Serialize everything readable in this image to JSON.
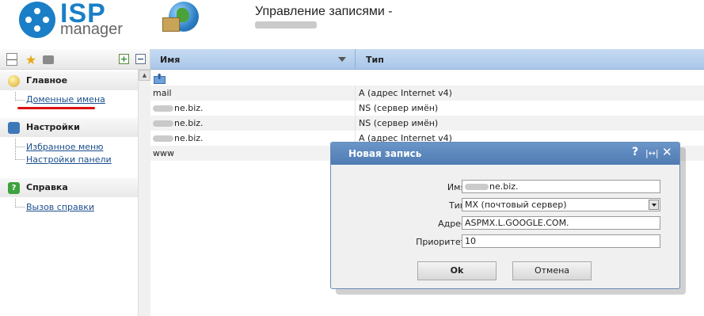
{
  "header": {
    "logo_top": "ISP",
    "logo_bottom": "manager",
    "title": "Управление записями -"
  },
  "sidebar": {
    "sections": [
      {
        "label": "Главное",
        "links": [
          "Доменные имена"
        ]
      },
      {
        "label": "Настройки",
        "links": [
          "Избранное меню",
          "Настройки панели"
        ]
      },
      {
        "label": "Справка",
        "links": [
          "Вызов справки"
        ]
      }
    ]
  },
  "table": {
    "columns": [
      "Имя",
      "Тип"
    ],
    "rows": [
      {
        "name": "mail",
        "type": "A (адрес Internet v4)"
      },
      {
        "name": "ne.biz.",
        "type": "NS (сервер имён)"
      },
      {
        "name": "ne.biz.",
        "type": "NS (сервер имён)"
      },
      {
        "name": "ne.biz.",
        "type": "A (адрес Internet v4)"
      },
      {
        "name": "www",
        "type": ""
      }
    ]
  },
  "dialog": {
    "title": "Новая запись",
    "help_icon": "?",
    "fields": {
      "name_label": "Имя",
      "name_value": "ne.biz.",
      "type_label": "Тип",
      "type_value": "MX (почтовый сервер)",
      "address_label": "Адрес",
      "address_value": "ASPMX.L.GOOGLE.COM.",
      "priority_label": "Приоритет",
      "priority_value": "10"
    },
    "ok_label": "Ok",
    "cancel_label": "Отмена"
  },
  "colors": {
    "brand": "#1a7fc6",
    "header_blue": "#a9c6e8",
    "dialog_title": "#4f7bb3",
    "link": "#1a4d8c",
    "highlight": "#e01010"
  },
  "icons": [
    "list-icon",
    "star-icon",
    "briefcase-icon",
    "expand-icon",
    "collapse-icon",
    "globe-icon",
    "up-folder-icon",
    "help-icon",
    "resize-icon",
    "close-icon"
  ]
}
